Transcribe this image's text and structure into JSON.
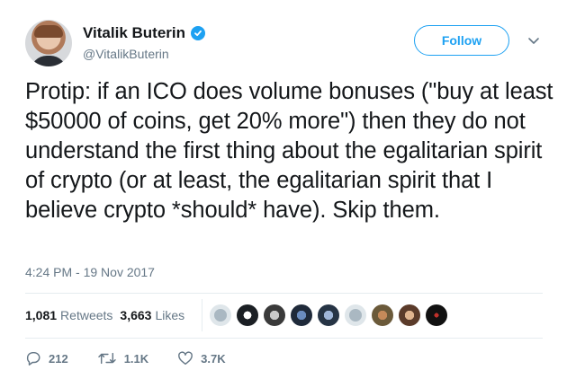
{
  "user": {
    "name": "Vitalik Buterin",
    "handle": "@VitalikButerin",
    "verified": true
  },
  "follow_label": "Follow",
  "tweet_text": "Protip: if an ICO does volume bonuses (\"buy at least $50000 of coins, get 20% more\") then they do not understand the first thing about the egalitarian spirit of crypto (or at least, the egalitarian spirit that I believe crypto *should* have). Skip them.",
  "timestamp": "4:24 PM - 19 Nov 2017",
  "stats": {
    "retweets_count": "1,081",
    "retweets_label": "Retweets",
    "likes_count": "3,663",
    "likes_label": "Likes"
  },
  "actions": {
    "replies": "212",
    "retweets": "1.1K",
    "likes": "3.7K"
  },
  "colors": {
    "accent": "#1da1f2",
    "secondary_text": "#657786",
    "divider": "#e6ecf0"
  }
}
